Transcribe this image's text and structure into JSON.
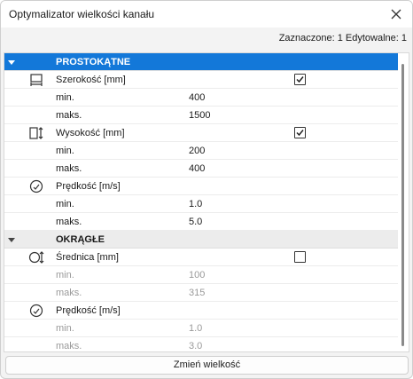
{
  "window": {
    "title": "Optymalizator wielkości kanału"
  },
  "status": {
    "text": "Zaznaczone: 1 Edytowalne: 1"
  },
  "sections": [
    {
      "label": "PROSTOKĄTNE",
      "properties": [
        {
          "icon": "width-dimension-icon",
          "label": "Szerokość [mm]",
          "checked": true,
          "min_label": "min.",
          "min": "400",
          "max_label": "maks.",
          "max": "1500"
        },
        {
          "icon": "height-dimension-icon",
          "label": "Wysokość [mm]",
          "checked": true,
          "min_label": "min.",
          "min": "200",
          "max_label": "maks.",
          "max": "400"
        },
        {
          "icon": "velocity-gauge-icon",
          "label": "Prędkość [m/s]",
          "min_label": "min.",
          "min": "1.0",
          "max_label": "maks.",
          "max": "5.0"
        }
      ]
    },
    {
      "label": "OKRĄGŁE",
      "properties": [
        {
          "icon": "diameter-dimension-icon",
          "label": "Średnica [mm]",
          "checked": false,
          "min_label": "min.",
          "min": "100",
          "max_label": "maks.",
          "max": "315"
        },
        {
          "icon": "velocity-gauge-icon",
          "label": "Prędkość [m/s]",
          "min_label": "min.",
          "min": "1.0",
          "max_label": "maks.",
          "max": "3.0"
        }
      ]
    }
  ],
  "actions": {
    "resize_label": "Zmień wielkość"
  },
  "colors": {
    "selection": "#1378d9",
    "section_bg": "#ececec",
    "disabled_text": "#9a9a9a"
  }
}
